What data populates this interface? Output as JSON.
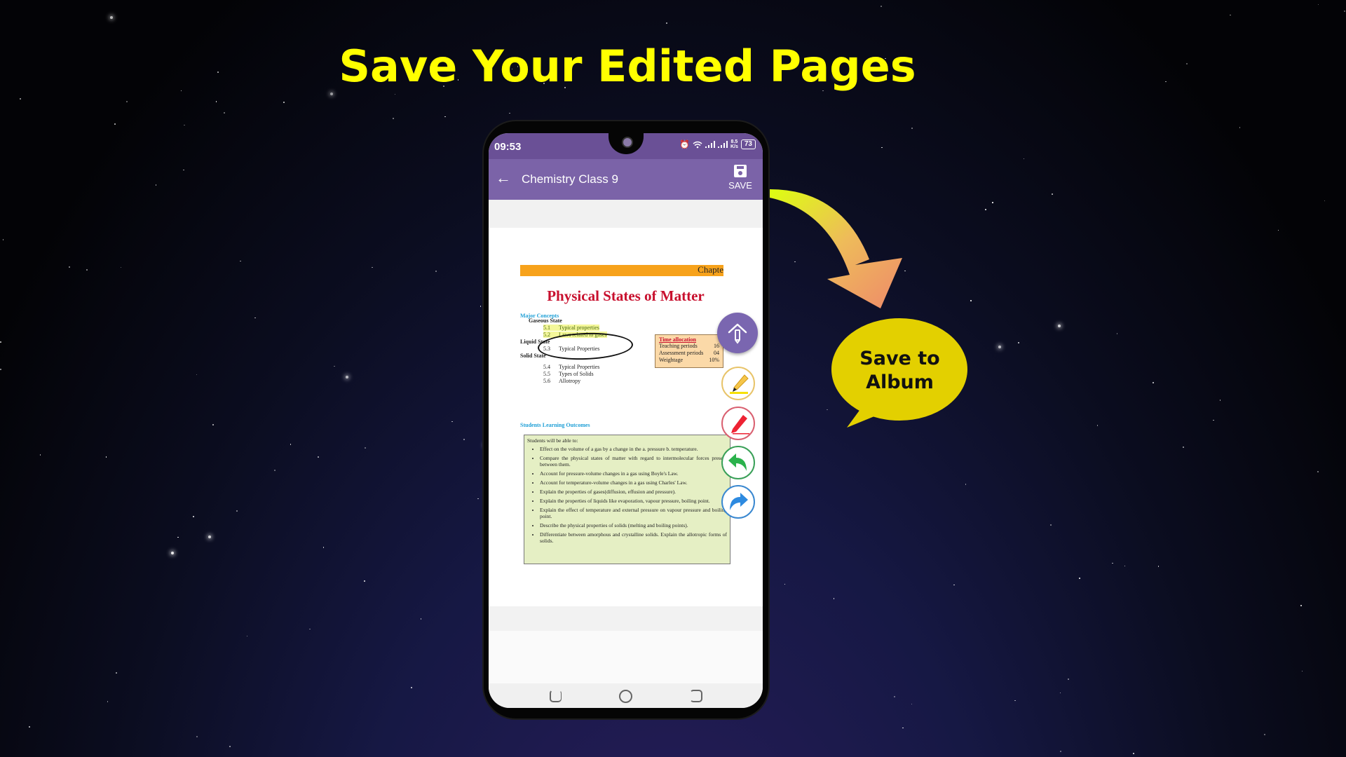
{
  "headline": "Save Your Edited Pages",
  "callout": {
    "line1": "Save to",
    "line2": "Album",
    "color": "#e3d000"
  },
  "phone": {
    "status_bar": {
      "time": "09:53",
      "net_speed_top": "8.5",
      "net_speed_bottom": "K/s",
      "battery": "73"
    },
    "app_bar": {
      "title": "Chemistry Class 9",
      "save_label": "SAVE",
      "color": "#7b63a8"
    },
    "document": {
      "chapter_label": "Chapte",
      "title": "Physical States of Matter",
      "major_concepts_heading": "Major Concepts",
      "concepts": [
        {
          "type": "head",
          "text": "Gaseous State"
        },
        {
          "type": "item",
          "num": "5.1",
          "text": "Typical properties",
          "highlighted": true
        },
        {
          "type": "item",
          "num": "5.2",
          "text": "Laws related to gases",
          "highlighted": true
        },
        {
          "type": "head",
          "text": "Liquid State"
        },
        {
          "type": "item",
          "num": "5.3",
          "text": "Typical Properties"
        },
        {
          "type": "head",
          "text": "Solid State"
        },
        {
          "type": "item",
          "num": "5.4",
          "text": "Typical Properties"
        },
        {
          "type": "item",
          "num": "5.5",
          "text": "Types of Solids"
        },
        {
          "type": "item",
          "num": "5.6",
          "text": "Allotropy"
        }
      ],
      "time_allocation": {
        "heading": "Time allocation",
        "rows": [
          {
            "label": "Teaching periods",
            "value": "16"
          },
          {
            "label": "Assessment periods",
            "value": "04"
          },
          {
            "label": "Weightage",
            "value": "10%"
          }
        ]
      },
      "outcomes_heading": "Students Learning Outcomes",
      "outcomes_intro": "Students will be able to:",
      "outcomes": [
        "Effect on the volume of a gas by a change in the a. pressure b. temperature.",
        "Compare the physical states of matter with regard to intermolecular forces present between them.",
        "Account for pressure-volume changes in a gas using Boyle's Law.",
        "Account for temperature-volume changes in a gas using Charles' Law.",
        "Explain the properties of gases(diffusion, effusion and pressure).",
        "Explain the properties of liquids like evaporation, vapour pressure, boiling point.",
        "Explain the effect of temperature and external pressure on vapour pressure and boiling point.",
        "Describe the physical properties of solids (melting and boiling points).",
        "Differentiate between amorphous and crystalline solids. Explain the allotropic forms of solids."
      ]
    },
    "tools": [
      {
        "name": "edit-menu",
        "icon": "upload-pencil-icon"
      },
      {
        "name": "highlighter",
        "icon": "highlighter-icon"
      },
      {
        "name": "pen",
        "icon": "pen-icon"
      },
      {
        "name": "undo",
        "icon": "undo-icon"
      },
      {
        "name": "redo",
        "icon": "redo-icon"
      }
    ],
    "nav_bar": [
      "recent-apps",
      "home",
      "back"
    ]
  }
}
